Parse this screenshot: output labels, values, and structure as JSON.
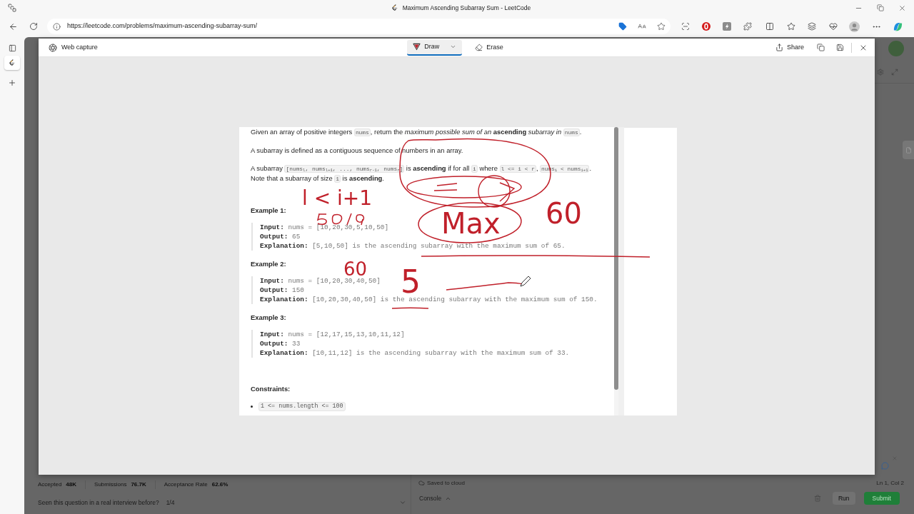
{
  "browser": {
    "title": "Maximum Ascending Subarray Sum - LeetCode",
    "url": "https://leetcode.com/problems/maximum-ascending-subarray-sum/",
    "vertical_tabs": [
      {
        "selected": true
      }
    ]
  },
  "web_capture": {
    "title": "Web capture",
    "tools": [
      {
        "kind": "draw",
        "label": "Draw",
        "selected": true
      },
      {
        "kind": "erase",
        "label": "Erase",
        "selected": false
      }
    ],
    "share": "Share"
  },
  "capture": {
    "paragraphs": [
      [
        {
          "kind": "text",
          "text": "Given an array of positive integers "
        },
        {
          "kind": "code",
          "text": "nums"
        },
        {
          "kind": "text",
          "text": ", return the *maximum possible sum of an* **ascending** *subarray in* "
        },
        {
          "kind": "code",
          "text": "nums"
        },
        {
          "kind": "text",
          "text": "."
        }
      ],
      [
        {
          "kind": "text",
          "text": "A subarray is defined as a contiguous sequence of numbers in an array."
        }
      ],
      [
        {
          "kind": "text",
          "text": "A subarray "
        },
        {
          "kind": "code",
          "text": "[nums$_{l}$, nums$_{l+1}$, ..., nums$_{r-1}$, nums$_{r}$]"
        },
        {
          "kind": "text",
          "text": " is **ascending** if for all "
        },
        {
          "kind": "code",
          "text": "i"
        },
        {
          "kind": "text",
          "text": " where "
        },
        {
          "kind": "code",
          "text": "l <= i < r"
        },
        {
          "kind": "text",
          "text": ", "
        },
        {
          "kind": "code",
          "text": "nums$_{i}$ < nums$_{i+1}$"
        },
        {
          "kind": "text",
          "text": ". Note that a subarray of size "
        },
        {
          "kind": "code",
          "text": "1"
        },
        {
          "kind": "text",
          "text": " is **ascending**."
        }
      ]
    ],
    "examples": [
      {
        "heading": "Example 1:",
        "lines": [
          {
            "label": "Input:",
            "value": "nums = [10,20,30,5,10,50]"
          },
          {
            "label": "Output:",
            "value": "65"
          },
          {
            "label": "Explanation:",
            "value": "[5,10,50] is the ascending subarray with the maximum sum of 65."
          }
        ]
      },
      {
        "heading": "Example 2:",
        "lines": [
          {
            "label": "Input:",
            "value": "nums = [10,20,30,40,50]"
          },
          {
            "label": "Output:",
            "value": "150"
          },
          {
            "label": "Explanation:",
            "value": "[10,20,30,40,50] is the ascending subarray with the maximum sum of 150."
          }
        ]
      },
      {
        "heading": "Example 3:",
        "lines": [
          {
            "label": "Input:",
            "value": "nums = [12,17,15,13,10,11,12]"
          },
          {
            "label": "Output:",
            "value": "33"
          },
          {
            "label": "Explanation:",
            "value": "[10,11,12] is the ascending subarray with the maximum sum of 33."
          }
        ]
      }
    ],
    "constraints": {
      "heading": "Constraints:",
      "items": [
        "1 <= nums.length <= 100"
      ]
    }
  },
  "ink": {
    "notes": [
      "l < i+1",
      "Max",
      "60",
      "60",
      "5"
    ]
  },
  "page_behind": {
    "stats": [
      {
        "label": "Accepted",
        "value": "48K"
      },
      {
        "label": "Submissions",
        "value": "76.7K"
      },
      {
        "label": "Acceptance Rate",
        "value": "62.6%"
      }
    ],
    "saved_status": "Saved to cloud",
    "cursor_position": "Ln 1, Col 2",
    "interview_prompt": "Seen this question in a real interview before?",
    "interview_page": "1/4",
    "console": "Console",
    "run": "Run",
    "submit": "Submit"
  }
}
